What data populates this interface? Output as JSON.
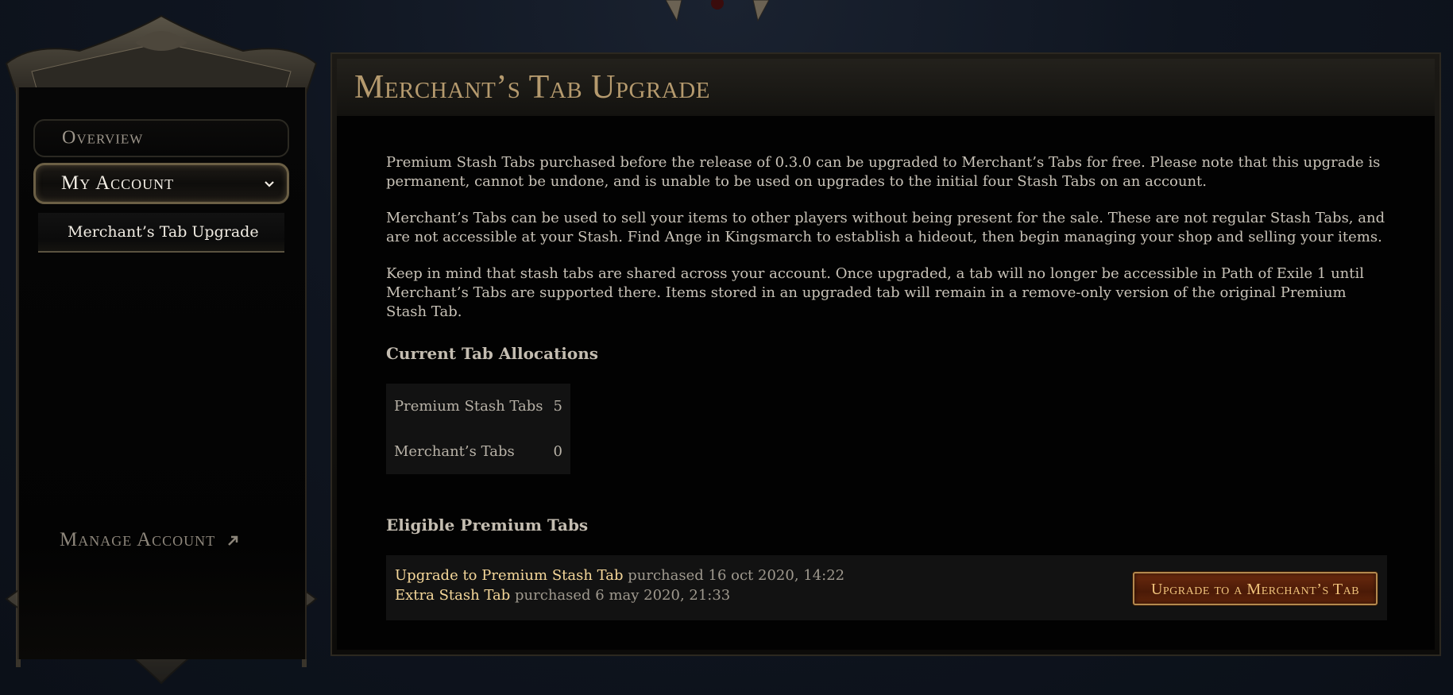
{
  "sidebar": {
    "overview_label": "Overview",
    "account_label": "My Account",
    "sub_item_label": "Merchant’s Tab Upgrade",
    "manage_label": "Manage Account"
  },
  "main": {
    "title": "Merchant’s Tab Upgrade",
    "paragraphs": [
      "Premium Stash Tabs purchased before the release of 0.3.0 can be upgraded to Merchant’s Tabs for free. Please note that this upgrade is permanent, cannot be undone, and is unable to be used on upgrades to the initial four Stash Tabs on an account.",
      "Merchant’s Tabs can be used to sell your items to other players without being present for the sale. These are not regular Stash Tabs, and are not accessible at your Stash. Find Ange in Kingsmarch to establish a hideout, then begin managing your shop and selling your items.",
      "Keep in mind that stash tabs are shared across your account. Once upgraded, a tab will no longer be accessible in Path of Exile 1 until Merchant’s Tabs are supported there. Items stored in an upgraded tab will remain in a remove-only version of the original Premium Stash Tab."
    ],
    "allocations_heading": "Current Tab Allocations",
    "allocations": [
      {
        "label": "Premium Stash Tabs",
        "value": "5"
      },
      {
        "label": "Merchant’s Tabs",
        "value": "0"
      }
    ],
    "eligible_heading": "Eligible Premium Tabs",
    "eligible_items": [
      {
        "name": "Upgrade to Premium Stash Tab",
        "meta": "purchased 16 oct 2020, 14:22"
      },
      {
        "name": "Extra Stash Tab",
        "meta": "purchased 6 may 2020, 21:33"
      }
    ],
    "upgrade_button_label": "Upgrade to a Merchant’s Tab"
  },
  "colors": {
    "title_gold": "#b59a6e",
    "item_gold": "#f6d89a",
    "button_bg": "#5a2209",
    "page_bg": "#0f1520"
  },
  "icons": [
    "chevron-down-icon",
    "external-link-icon",
    "ornament-frame"
  ]
}
